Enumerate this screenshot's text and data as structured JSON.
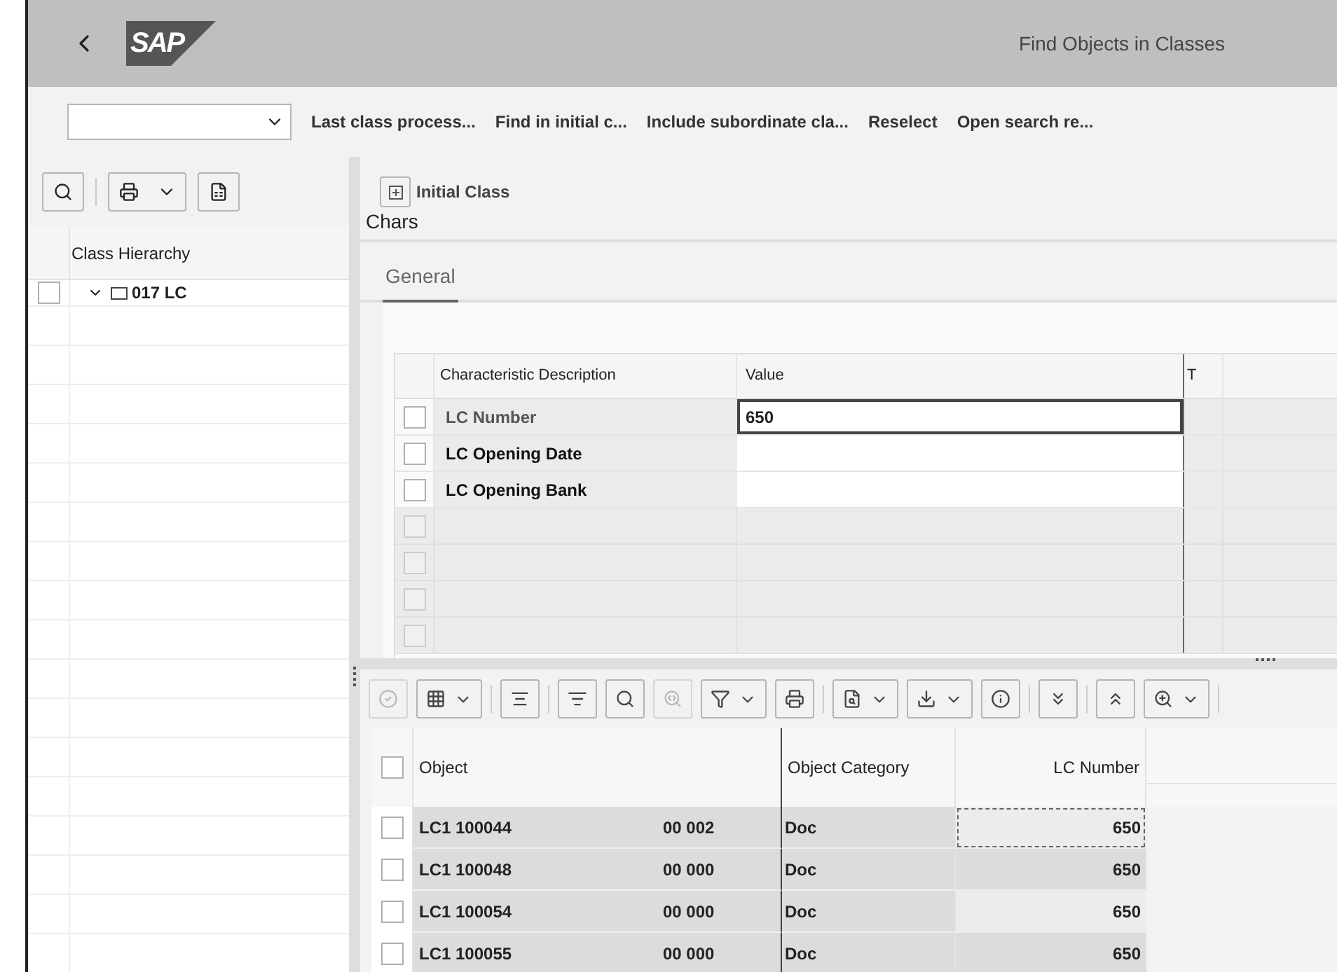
{
  "header": {
    "logo": "SAP",
    "title": "Find Objects in Classes"
  },
  "toolbar": {
    "actions": [
      "Last class process...",
      "Find in initial c...",
      "Include subordinate cla...",
      "Reselect",
      "Open search re..."
    ]
  },
  "hierarchy": {
    "column": "Class Hierarchy",
    "items": [
      {
        "label": "017 LC",
        "expanded": true,
        "checked": false
      }
    ]
  },
  "initial_class": {
    "label": "Initial Class"
  },
  "chars": {
    "title": "Chars",
    "tabs": [
      {
        "label": "General",
        "selected": true
      }
    ],
    "columns": [
      "Characteristic Description",
      "Value",
      "T"
    ],
    "rows": [
      {
        "description": "LC Number",
        "value": "650",
        "focused": true,
        "checked": false
      },
      {
        "description": "LC Opening Date",
        "focused": false,
        "checked": false
      },
      {
        "description": "LC Opening Bank",
        "focused": false,
        "checked": false
      }
    ],
    "blank_rows": [
      {
        "checked": false
      },
      {
        "checked": false
      },
      {
        "checked": false
      },
      {
        "checked": false
      }
    ]
  },
  "result_toolbar": [
    {
      "disabled": true,
      "menu": false
    },
    {
      "disabled": false,
      "menu": true
    },
    {
      "disabled": false,
      "menu": false
    },
    {
      "disabled": false,
      "menu": false
    },
    {
      "disabled": false,
      "menu": false
    },
    {
      "disabled": true,
      "menu": false
    },
    {
      "disabled": false,
      "menu": true
    },
    {
      "disabled": false,
      "menu": false
    },
    {
      "disabled": false,
      "menu": true
    },
    {
      "disabled": false,
      "menu": true
    },
    {
      "disabled": false,
      "menu": false
    },
    {
      "disabled": false,
      "menu": false
    },
    {
      "disabled": false,
      "menu": false
    },
    {
      "disabled": false,
      "menu": true
    }
  ],
  "results": {
    "all_checked": false,
    "columns": [
      "Object",
      "Object Category",
      "LC Number"
    ],
    "rows": [
      {
        "object": "LC1 100044",
        "version": "00 002",
        "category": "Doc",
        "lc_number": "650",
        "focused": true,
        "checked": false
      },
      {
        "object": "LC1 100048",
        "version": "00 000",
        "category": "Doc",
        "lc_number": "650",
        "focused": false,
        "checked": false
      },
      {
        "object": "LC1 100054",
        "version": "00 000",
        "category": "Doc",
        "lc_number": "650",
        "focused": false,
        "checked": false
      },
      {
        "object": "LC1 100055",
        "version": "00 000",
        "category": "Doc",
        "lc_number": "650",
        "focused": false,
        "checked": false
      }
    ]
  }
}
